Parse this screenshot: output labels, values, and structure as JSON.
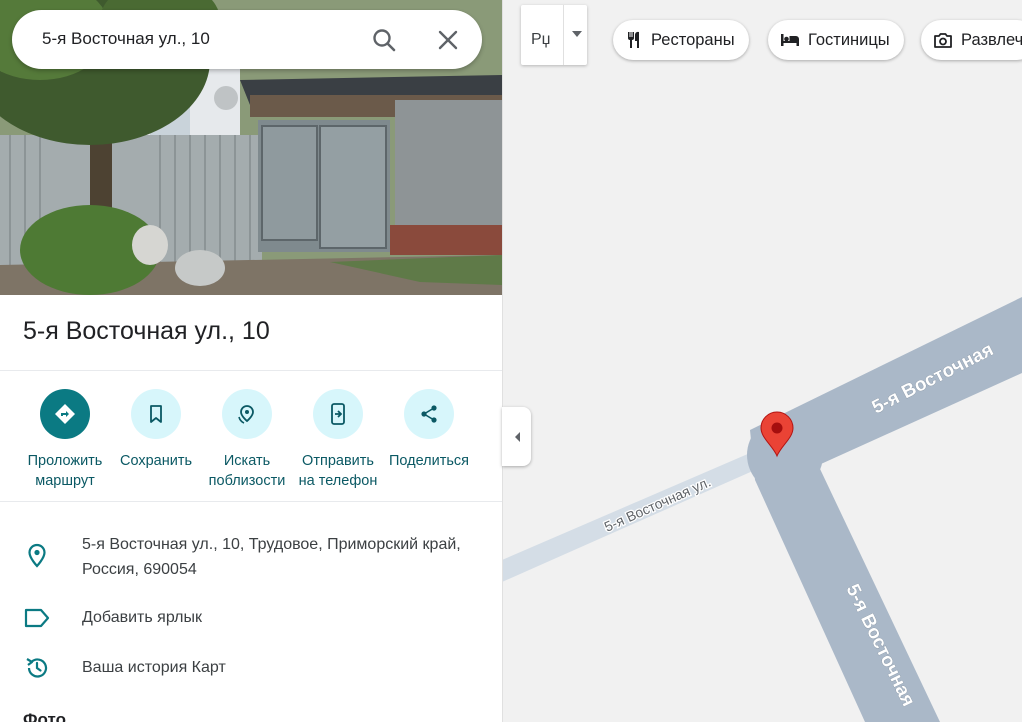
{
  "search": {
    "value": "5-я Восточная ул., 10"
  },
  "place": {
    "title": "5-я Восточная ул., 10",
    "address": "5-я Восточная ул., 10, Трудовое, Приморский край, Россия, 690054",
    "add_label": "Добавить ярлык",
    "history": "Ваша история Карт",
    "photos_heading": "Фото"
  },
  "actions": [
    {
      "label": "Проложить\nмаршрут",
      "icon": "directions-icon"
    },
    {
      "label": "Сохранить",
      "icon": "bookmark-icon"
    },
    {
      "label": "Искать\nпоблизости",
      "icon": "nearby-icon"
    },
    {
      "label": "Отправить\nна телефон",
      "icon": "send-to-phone-icon"
    },
    {
      "label": "Поделиться",
      "icon": "share-icon"
    }
  ],
  "map": {
    "layer_value": "Рџ",
    "chips": [
      {
        "label": "Рестораны",
        "icon": "restaurant-icon"
      },
      {
        "label": "Гостиницы",
        "icon": "hotel-icon"
      },
      {
        "label": "Развлеч",
        "icon": "camera-icon"
      }
    ],
    "streets": {
      "upper_right": "5-я Восточная",
      "lower_left": "5-я Восточная ул.",
      "lower_vertical": "5-я Восточная"
    },
    "colors": {
      "major_road": "#aab8c8",
      "minor_road": "#d4dde6",
      "pin": "#ea4335",
      "background": "#f1f1f1"
    }
  }
}
